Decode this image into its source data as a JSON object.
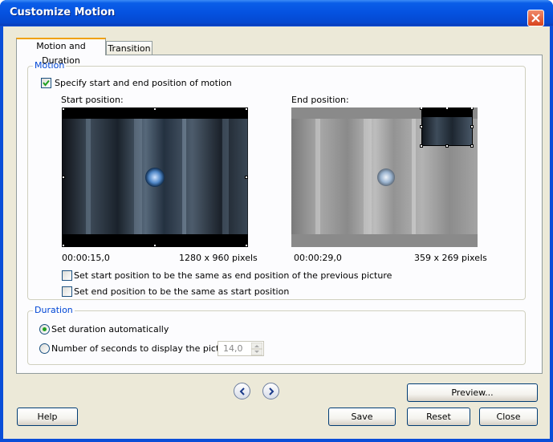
{
  "window": {
    "title": "Customize Motion"
  },
  "tabs": [
    {
      "label": "Motion and Duration",
      "active": true
    },
    {
      "label": "Transition",
      "active": false
    }
  ],
  "motion": {
    "group_label": "Motion",
    "specify_label": "Specify start and end position of motion",
    "specify_checked": true,
    "start": {
      "label": "Start position:",
      "time": "00:00:15,0",
      "size": "1280 x 960 pixels"
    },
    "end": {
      "label": "End position:",
      "time": "00:00:29,0",
      "size": "359 x 269 pixels"
    },
    "same_as_prev_label": "Set start position to be the same as end position of the previous picture",
    "same_as_prev_checked": false,
    "end_same_label": "Set end position to be the same as start position",
    "end_same_checked": false
  },
  "duration": {
    "group_label": "Duration",
    "auto_label": "Set duration automatically",
    "manual_label": "Number of seconds to display the picture",
    "selected": "auto",
    "seconds_value": "14,0"
  },
  "buttons": {
    "preview": "Preview...",
    "help": "Help",
    "save": "Save",
    "reset": "Reset",
    "close": "Close"
  },
  "colors": {
    "title_blue": "#0552e0",
    "group_title": "#0046d5",
    "radio_green": "#21a121",
    "tab_highlight": "#f0a000"
  }
}
